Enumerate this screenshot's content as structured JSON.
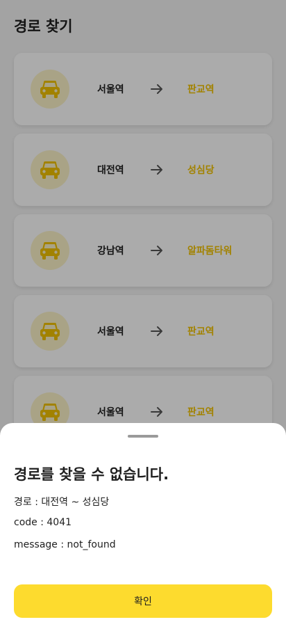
{
  "header": {
    "title": "경로 찾기"
  },
  "routes": [
    {
      "from": "서울역",
      "to": "판교역"
    },
    {
      "from": "대전역",
      "to": "성심당"
    },
    {
      "from": "강남역",
      "to": "알파돔타워"
    },
    {
      "from": "서울역",
      "to": "판교역"
    },
    {
      "from": "서울역",
      "to": "판교역"
    }
  ],
  "colors": {
    "accent": "#fddb2e",
    "destination_text": "#f2c200",
    "car_icon": "#f2c200",
    "car_circle_bg": "#fdf3c8"
  },
  "icons": {
    "route_icon": "car-icon",
    "direction_icon": "arrow-right-icon"
  },
  "error_sheet": {
    "title": "경로를 찾을 수 없습니다.",
    "route_line": "경로 : 대전역 ~ 성심당",
    "code_line": "code : 4041",
    "message_line": "message : not_found",
    "confirm_label": "확인"
  }
}
